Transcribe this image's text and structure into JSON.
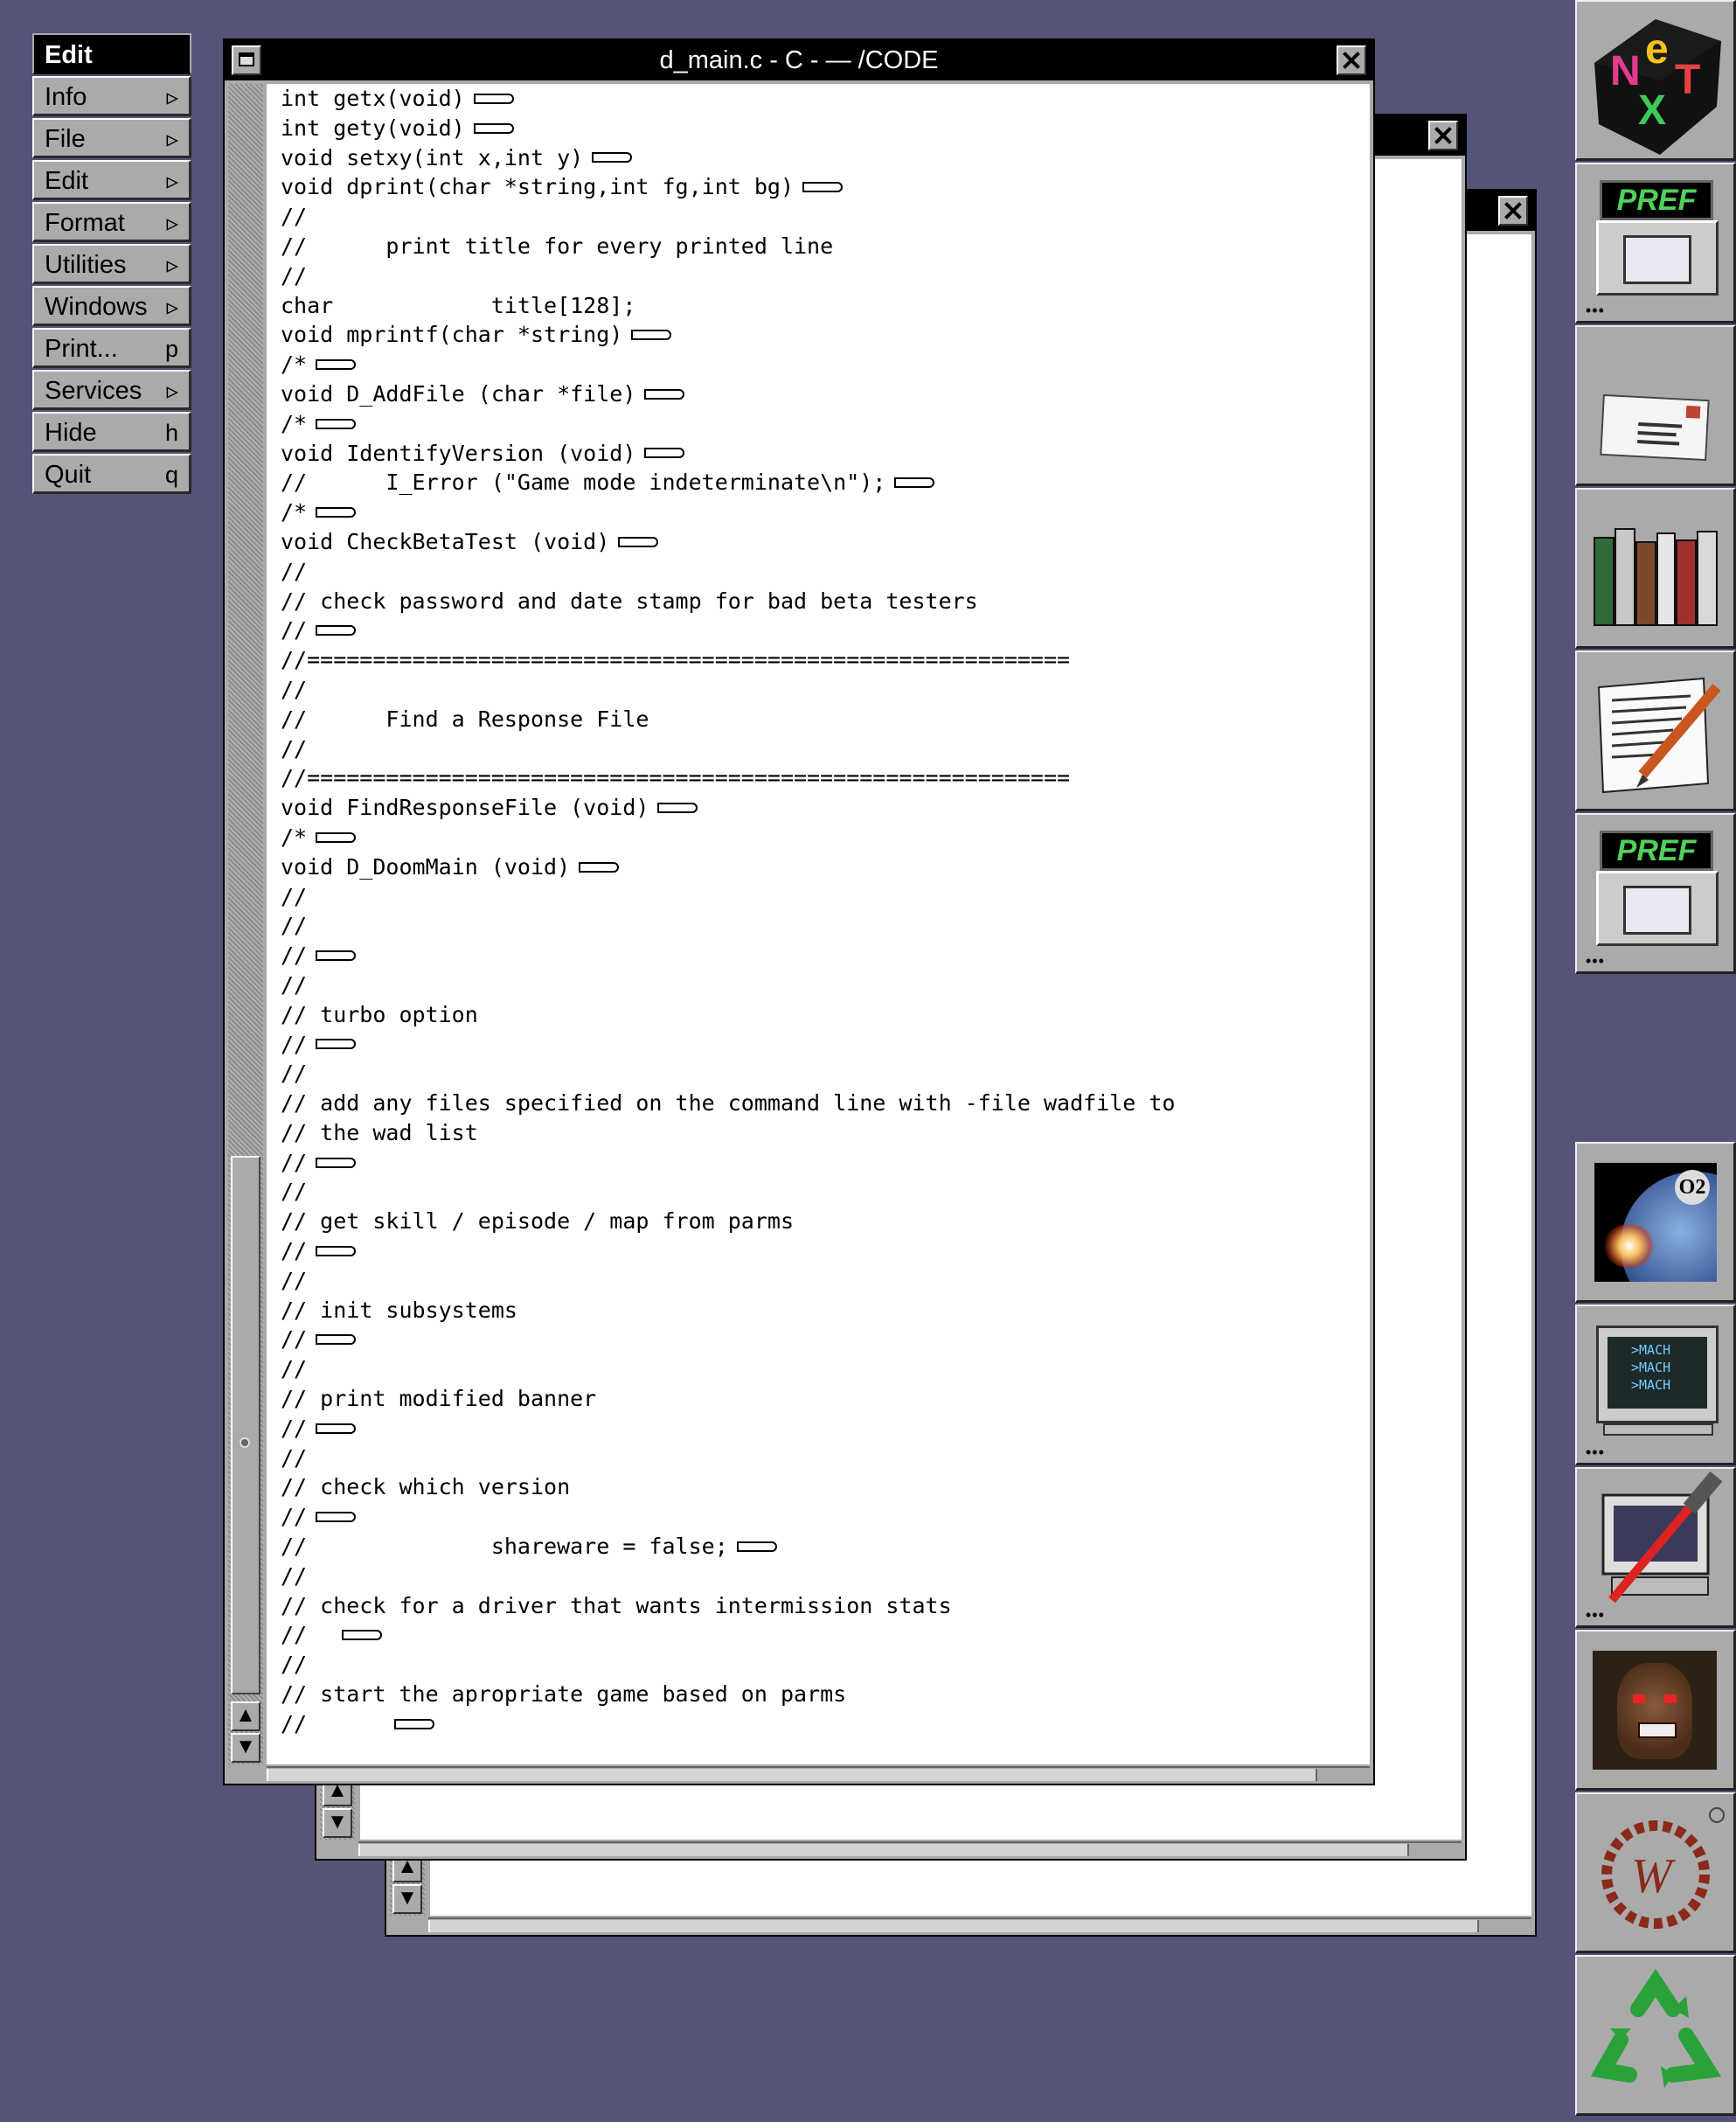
{
  "menu": {
    "title": "Edit",
    "items": [
      {
        "label": "Info",
        "key": "▹"
      },
      {
        "label": "File",
        "key": "▹"
      },
      {
        "label": "Edit",
        "key": "▹"
      },
      {
        "label": "Format",
        "key": "▹"
      },
      {
        "label": "Utilities",
        "key": "▹"
      },
      {
        "label": "Windows",
        "key": "▹"
      },
      {
        "label": "Print...",
        "key": "p"
      },
      {
        "label": "Services",
        "key": "▹"
      },
      {
        "label": "Hide",
        "key": "h"
      },
      {
        "label": "Quit",
        "key": "q"
      }
    ]
  },
  "front_window": {
    "title": "d_main.c - C -  — /CODE",
    "lines": [
      {
        "text": "int getx(void)",
        "fold": true
      },
      {
        "text": "int gety(void)",
        "fold": true
      },
      {
        "text": "void setxy(int x,int y)",
        "fold": true
      },
      {
        "text": "void dprint(char *string,int fg,int bg)",
        "fold": true
      },
      {
        "text": "//",
        "fold": false
      },
      {
        "text": "//      print title for every printed line",
        "fold": false
      },
      {
        "text": "//",
        "fold": false
      },
      {
        "text": "char            title[128];",
        "fold": false
      },
      {
        "text": "void mprintf(char *string)",
        "fold": true
      },
      {
        "text": "/*",
        "fold": true
      },
      {
        "text": "void D_AddFile (char *file)",
        "fold": true
      },
      {
        "text": "/*",
        "fold": true
      },
      {
        "text": "void IdentifyVersion (void)",
        "fold": true
      },
      {
        "text": "//      I_Error (\"Game mode indeterminate\\n\");",
        "fold": true
      },
      {
        "text": "/*",
        "fold": true
      },
      {
        "text": "void CheckBetaTest (void)",
        "fold": true
      },
      {
        "text": "//",
        "fold": false
      },
      {
        "text": "// check password and date stamp for bad beta testers",
        "fold": false
      },
      {
        "text": "//",
        "fold": true
      },
      {
        "text": "//==========================================================",
        "fold": false
      },
      {
        "text": "//",
        "fold": false
      },
      {
        "text": "//      Find a Response File",
        "fold": false
      },
      {
        "text": "//",
        "fold": false
      },
      {
        "text": "//==========================================================",
        "fold": false
      },
      {
        "text": "void FindResponseFile (void)",
        "fold": true
      },
      {
        "text": "/*",
        "fold": true
      },
      {
        "text": "void D_DoomMain (void)",
        "fold": true
      },
      {
        "text": "//",
        "fold": false
      },
      {
        "text": "//",
        "fold": false
      },
      {
        "text": "//",
        "fold": true
      },
      {
        "text": "//",
        "fold": false
      },
      {
        "text": "// turbo option",
        "fold": false
      },
      {
        "text": "//",
        "fold": true
      },
      {
        "text": "//",
        "fold": false
      },
      {
        "text": "// add any files specified on the command line with -file wadfile to",
        "fold": false
      },
      {
        "text": "// the wad list",
        "fold": false
      },
      {
        "text": "//",
        "fold": true
      },
      {
        "text": "//",
        "fold": false
      },
      {
        "text": "// get skill / episode / map from parms",
        "fold": false
      },
      {
        "text": "//",
        "fold": true
      },
      {
        "text": "//",
        "fold": false
      },
      {
        "text": "// init subsystems",
        "fold": false
      },
      {
        "text": "//",
        "fold": true
      },
      {
        "text": "//",
        "fold": false
      },
      {
        "text": "// print modified banner",
        "fold": false
      },
      {
        "text": "//",
        "fold": true
      },
      {
        "text": "//",
        "fold": false
      },
      {
        "text": "// check which version",
        "fold": false
      },
      {
        "text": "//",
        "fold": true
      },
      {
        "text": "//              shareware = false;",
        "fold": true
      },
      {
        "text": "//",
        "fold": false
      },
      {
        "text": "// check for a driver that wants intermission stats",
        "fold": false
      },
      {
        "text": "//  ",
        "fold": true
      },
      {
        "text": "//",
        "fold": false
      },
      {
        "text": "// start the apropriate game based on parms",
        "fold": false
      },
      {
        "text": "//      ",
        "fold": true
      }
    ]
  },
  "back_window_1": {
    "bottom_line": "//        "
  },
  "back_window_2": {
    "bottom_line": "//        "
  },
  "dock": {
    "pref_label": "PREF",
    "mach_lines": [
      ">MACH",
      ">MACH",
      ">MACH"
    ],
    "o2_label": "O2"
  },
  "colors": {
    "desktop": "#545479",
    "chrome_gray": "#aaaaaa",
    "pref_green": "#4fd15a"
  }
}
